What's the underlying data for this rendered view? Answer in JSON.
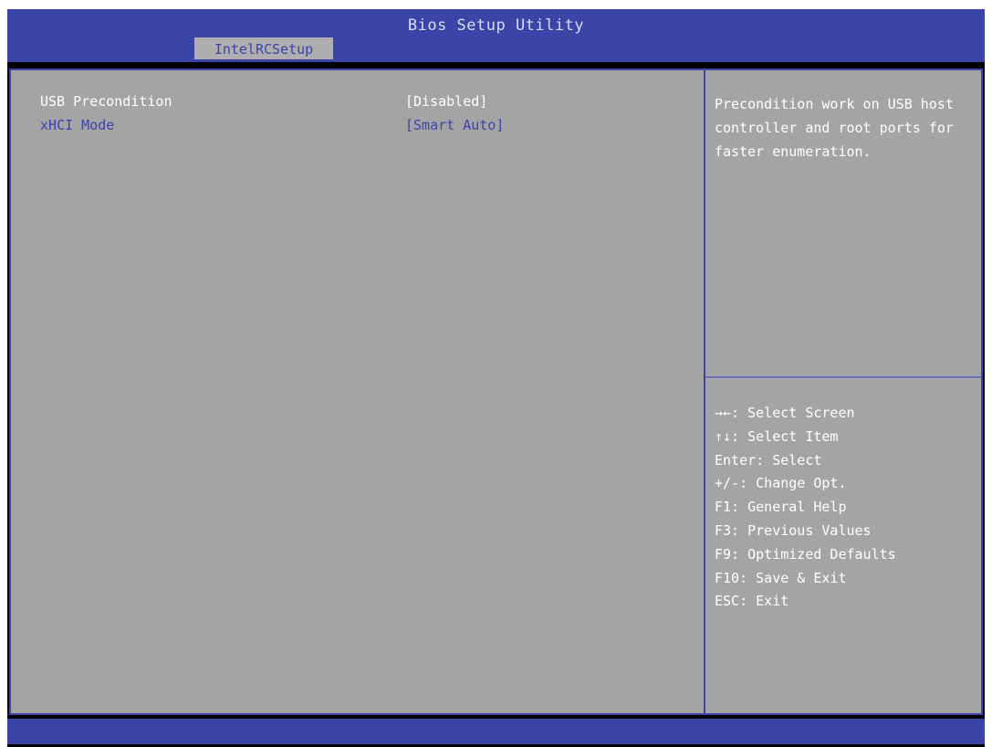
{
  "window": {
    "title": "Bios Setup Utility"
  },
  "tabs": [
    {
      "label": "IntelRCSetup",
      "active": true
    }
  ],
  "settings": [
    {
      "label": "USB Precondition",
      "value": "[Disabled]",
      "selected": true
    },
    {
      "label": "xHCI Mode",
      "value": "[Smart Auto]",
      "selected": false
    }
  ],
  "help": {
    "text": "Precondition work on USB host controller and root ports for faster enumeration."
  },
  "legend": [
    {
      "text": "→←: Select Screen"
    },
    {
      "text": "↑↓: Select Item"
    },
    {
      "text": "Enter: Select"
    },
    {
      "text": "+/-: Change Opt."
    },
    {
      "text": "F1: General Help"
    },
    {
      "text": "F3: Previous Values"
    },
    {
      "text": "F9: Optimized Defaults"
    },
    {
      "text": "F10: Save & Exit"
    },
    {
      "text": "ESC: Exit"
    }
  ],
  "colors": {
    "header_blue": "#3b45a8",
    "panel_gray": "#a4a4a4",
    "tab_gray": "#aeaeae",
    "text_white": "#ffffff",
    "text_blue": "#3b45a8"
  }
}
